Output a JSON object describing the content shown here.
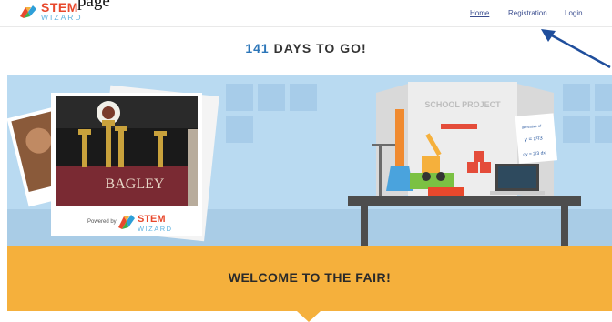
{
  "header": {
    "top_word": "page",
    "logo": {
      "stem": "STEM",
      "wizard": "WIZARD"
    },
    "nav": [
      "Home",
      "Registration",
      "Login"
    ]
  },
  "countdown": {
    "number": "141",
    "text": "DAYS TO GO!"
  },
  "hero": {
    "photo_lines": [
      "BAGLEY"
    ],
    "powered_by": "Powered by",
    "board_title": "SCHOOL PROJECT",
    "board_note": [
      "derivative of",
      "y = x²/3",
      "dy = 2/3 dx"
    ]
  },
  "welcome": {
    "text": "WELCOME TO THE FAIR!"
  },
  "colors": {
    "brand_red": "#e8482c",
    "brand_blue": "#5fb3e0",
    "accent_yellow": "#f5b03c",
    "hero_blue": "#b9daf1",
    "annotation_arrow": "#1f4e9c"
  }
}
